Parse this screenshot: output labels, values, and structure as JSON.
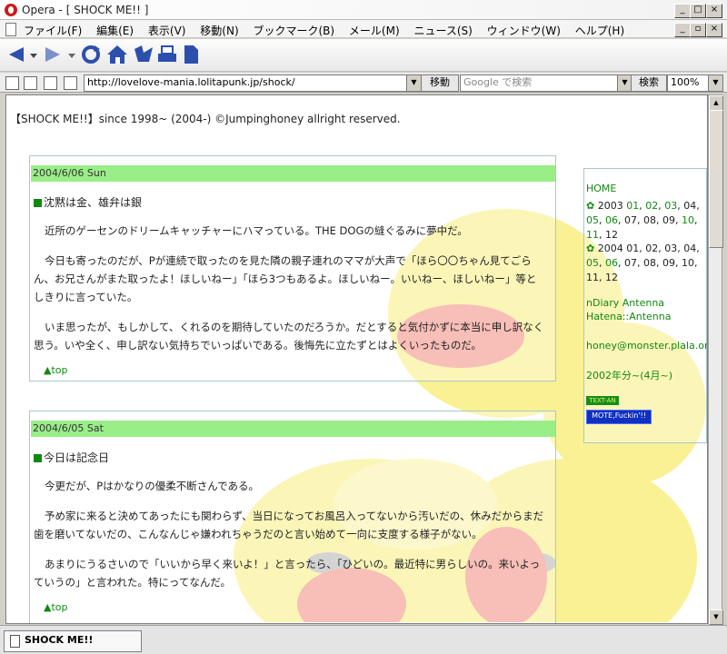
{
  "window": {
    "title": "Opera - [ SHOCK ME!! ]",
    "minimize": "_",
    "maximize": "□",
    "close": "×"
  },
  "menu": {
    "items": [
      "ファイル(F)",
      "編集(E)",
      "表示(V)",
      "移動(N)",
      "ブックマーク(B)",
      "メール(M)",
      "ニュース(S)",
      "ウィンドウ(W)",
      "ヘルプ(H)"
    ]
  },
  "toolbar": {
    "icons": [
      "back-icon",
      "forward-icon",
      "reload-icon",
      "home-icon",
      "hotlist-icon",
      "print-icon",
      "page-icon"
    ]
  },
  "address": {
    "url": "http://lovelove-mania.lolitapunk.jp/shock/",
    "go_label": "移動",
    "search_placeholder": "Google で検索",
    "search_label": "検索",
    "zoom": "100%"
  },
  "page": {
    "copyright": "【SHOCK ME!!】since 1998~ (2004-) ©Jumpinghoney allright reserved.",
    "entries": [
      {
        "date": "2004/6/06 Sun",
        "title": "沈黙は金、雄弁は銀",
        "paragraphs": [
          "近所のゲーセンのドリームキャッチャーにハマっている。THE DOGの縫ぐるみに夢中だ。",
          "今日も寄ったのだが、Pが連続で取ったのを見た隣の親子連れのママが大声で「ほら〇〇ちゃん見てごらん、お兄さんがまた取ったよ！ほしいねー」「ほら3つもあるよ。ほしいねー。いいねー、ほしいねー」等としきりに言っていた。",
          "いま思ったが、もしかして、くれるのを期待していたのだろうか。だとすると気付かずに本当に申し訳なく思う。いや全く、申し訳ない気持ちでいっぱいである。後悔先に立たずとはよくいったものだ。"
        ],
        "top": "▲top"
      },
      {
        "date": "2004/6/05 Sat",
        "title": "今日は記念日",
        "paragraphs": [
          "今更だが、Pはかなりの優柔不断さんである。",
          "予め家に来ると決めてあったにも関わらず、当日になってお風呂入ってないから汚いだの、休みだからまだ歯を磨いてないだの、こんなんじゃ嫌われちゃうだのと言い始めて一向に支度する様子がない。",
          "あまりにうるさいので「いいから早く来いよ！」と言ったら、「ひどいの。最近特に男らしいの。来いよっていうの」と言われた。特にってなんだ。"
        ],
        "top": "▲top"
      }
    ],
    "sidebar": {
      "home": "HOME",
      "year2003": {
        "label": "2003",
        "months": [
          "01",
          "02",
          "03",
          "04",
          "05",
          "06",
          "07",
          "08",
          "09",
          "10",
          "11",
          "12"
        ]
      },
      "year2004": {
        "label": "2004",
        "months": [
          "01",
          "02",
          "03",
          "04",
          "05",
          "06",
          "07",
          "08",
          "09",
          "10",
          "11",
          "12"
        ]
      },
      "antenna1": "nDiary Antenna",
      "antenna2": "Hatena::Antenna",
      "email": "honey@monster.plala.or.jp",
      "since": "2002年分~(4月~)",
      "banner1": "TEXT-AN",
      "banner2": "MOTE,Fuckin'!!"
    }
  },
  "status": {
    "tab_label": "SHOCK ME!!"
  },
  "colors": {
    "date_bar": "#99ee88",
    "link_green": "#118811",
    "duck_yellow": "#f5e63c",
    "duck_beak": "#ee4a3a"
  }
}
